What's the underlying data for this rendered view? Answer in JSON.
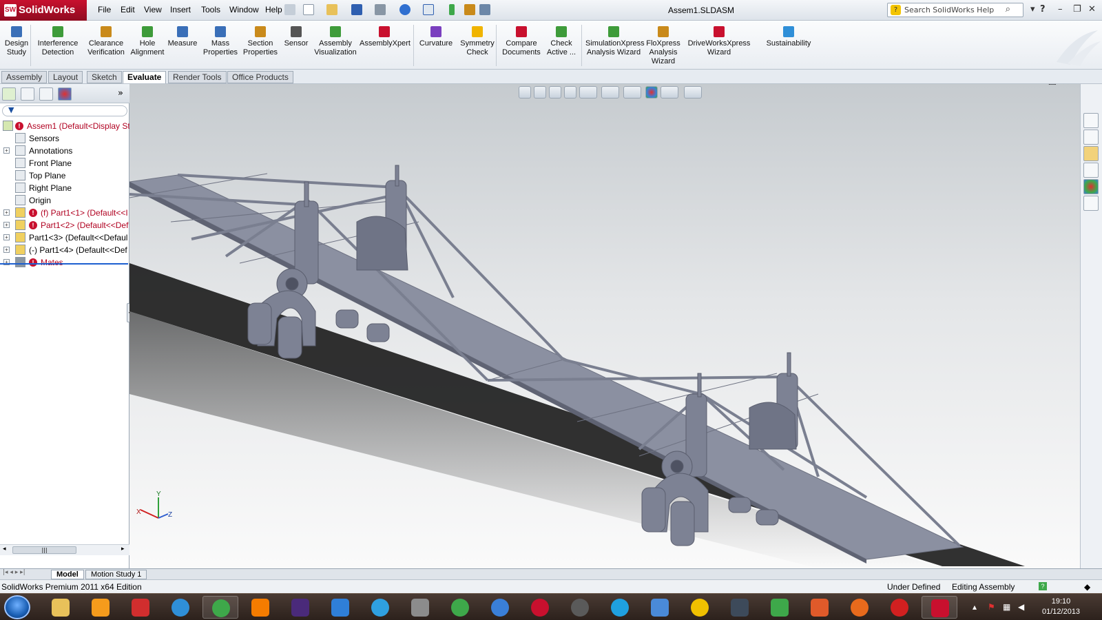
{
  "app": {
    "name": "SolidWorks",
    "document_title": "Assem1.SLDASM",
    "search_placeholder": "Search SolidWorks Help"
  },
  "menu": [
    "File",
    "Edit",
    "View",
    "Insert",
    "Tools",
    "Window",
    "Help"
  ],
  "toolbar": {
    "tools": [
      {
        "label": "Design Study",
        "color": "#3a6fb8"
      },
      {
        "label": "Interference Detection",
        "color": "#3e9b3a"
      },
      {
        "label": "Clearance Verification",
        "color": "#c98a1b"
      },
      {
        "label": "Hole Alignment",
        "color": "#3e9b3a"
      },
      {
        "label": "Measure",
        "color": "#3a6fb8"
      },
      {
        "label": "Mass Properties",
        "color": "#3a6fb8"
      },
      {
        "label": "Section Properties",
        "color": "#c98a1b"
      },
      {
        "label": "Sensor",
        "color": "#555555"
      },
      {
        "label": "Assembly Visualization",
        "color": "#3e9b3a"
      },
      {
        "label": "AssemblyXpert",
        "color": "#c8102e"
      },
      {
        "label": "Curvature",
        "color": "#7a3fbf"
      },
      {
        "label": "Symmetry Check",
        "color": "#f0b400"
      },
      {
        "label": "Compare Documents",
        "color": "#c8102e"
      },
      {
        "label": "Check Active ...",
        "color": "#3e9b3a"
      },
      {
        "label": "SimulationXpress Analysis Wizard",
        "color": "#3e9b3a"
      },
      {
        "label": "FloXpress Analysis Wizard",
        "color": "#c98a1b"
      },
      {
        "label": "DriveWorksXpress Wizard",
        "color": "#c8102e"
      },
      {
        "label": "Sustainability",
        "color": "#2f8fd8"
      }
    ]
  },
  "tabs": [
    "Assembly",
    "Layout",
    "Sketch",
    "Evaluate",
    "Render Tools",
    "Office Products"
  ],
  "active_tab": "Evaluate",
  "tree": [
    {
      "label": "Assem1  (Default<Display St",
      "error": true,
      "exp": false,
      "color": "#b00020"
    },
    {
      "label": "Sensors",
      "error": false,
      "exp": false,
      "color": "#000000"
    },
    {
      "label": "Annotations",
      "error": false,
      "exp": true,
      "color": "#000000"
    },
    {
      "label": "Front Plane",
      "error": false,
      "exp": false,
      "color": "#000000"
    },
    {
      "label": "Top Plane",
      "error": false,
      "exp": false,
      "color": "#000000"
    },
    {
      "label": "Right Plane",
      "error": false,
      "exp": false,
      "color": "#000000"
    },
    {
      "label": "Origin",
      "error": false,
      "exp": false,
      "color": "#000000"
    },
    {
      "label": "(f) Part1<1> (Default<<I",
      "error": true,
      "exp": true,
      "color": "#b00020"
    },
    {
      "label": "Part1<2> (Default<<Def",
      "error": true,
      "exp": true,
      "color": "#b00020"
    },
    {
      "label": "Part1<3> (Default<<Defaul",
      "error": false,
      "exp": true,
      "color": "#000000"
    },
    {
      "label": "(-) Part1<4> (Default<<Def",
      "error": false,
      "exp": true,
      "color": "#000000"
    },
    {
      "label": "Mates",
      "error": true,
      "exp": true,
      "color": "#b00020"
    }
  ],
  "bottom_tabs": [
    "Model",
    "Motion Study 1"
  ],
  "status": {
    "edition": "SolidWorks Premium 2011 x64 Edition",
    "state": "Under Defined",
    "mode": "Editing Assembly"
  },
  "taskbar": {
    "apps": [
      {
        "name": "explorer",
        "color": "#e8c15a",
        "open": false
      },
      {
        "name": "media-player",
        "color": "#f59b1c",
        "open": false
      },
      {
        "name": "pdf",
        "color": "#d12e2e",
        "open": false
      },
      {
        "name": "video-player",
        "color": "#2f8fd8",
        "open": false
      },
      {
        "name": "chrome",
        "color": "#3ea84a",
        "open": true
      },
      {
        "name": "vlc",
        "color": "#f57c00",
        "open": false
      },
      {
        "name": "after-effects",
        "color": "#4a2a7a",
        "open": false
      },
      {
        "name": "downloader",
        "color": "#2f7fd8",
        "open": false
      },
      {
        "name": "quicktime",
        "color": "#2fa0e0",
        "open": false
      },
      {
        "name": "game",
        "color": "#8c8c8c",
        "open": false
      },
      {
        "name": "utorrent",
        "color": "#3ea84a",
        "open": false
      },
      {
        "name": "ccleaner",
        "color": "#3a7fd8",
        "open": false
      },
      {
        "name": "antivirus",
        "color": "#c8102e",
        "open": false
      },
      {
        "name": "film",
        "color": "#5a5a5a",
        "open": false
      },
      {
        "name": "skype",
        "color": "#1fa0e0",
        "open": false
      },
      {
        "name": "network",
        "color": "#4a8ad8",
        "open": false
      },
      {
        "name": "disc",
        "color": "#f0c000",
        "open": false
      },
      {
        "name": "lightroom",
        "color": "#3d4a5a",
        "open": false
      },
      {
        "name": "camtasia",
        "color": "#3ea84a",
        "open": false
      },
      {
        "name": "office",
        "color": "#e05a2a",
        "open": false
      },
      {
        "name": "firefox",
        "color": "#e86a1c",
        "open": false
      },
      {
        "name": "opera",
        "color": "#d12020",
        "open": false
      },
      {
        "name": "solidworks",
        "color": "#c8102e",
        "open": true
      }
    ],
    "time": "19:10",
    "date": "01/12/2013"
  },
  "colors": {
    "model": "#8a8fa0",
    "model_dark": "#5e6273",
    "accent": "#c8102e"
  }
}
